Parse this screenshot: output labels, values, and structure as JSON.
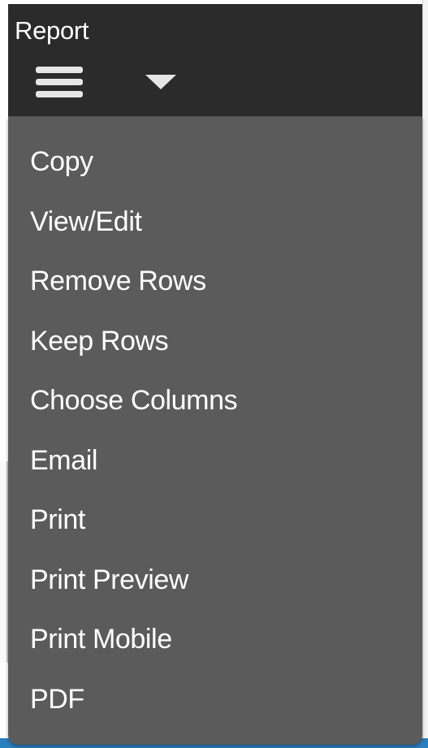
{
  "header": {
    "title": "Report",
    "menu_icon": "hamburger-icon",
    "dropdown_icon": "caret-down-icon"
  },
  "menu": {
    "items": [
      {
        "label": "Copy"
      },
      {
        "label": "View/Edit"
      },
      {
        "label": "Remove Rows"
      },
      {
        "label": "Keep Rows"
      },
      {
        "label": "Choose Columns"
      },
      {
        "label": "Email"
      },
      {
        "label": "Print"
      },
      {
        "label": "Print Preview"
      },
      {
        "label": "Print Mobile"
      },
      {
        "label": "PDF"
      }
    ]
  },
  "colors": {
    "header_bg": "#2b2b2b",
    "menu_bg": "#5b5b5b",
    "text": "#ffffff",
    "icon": "#e6e6e6",
    "accent_bar": "#2a7fbf"
  }
}
